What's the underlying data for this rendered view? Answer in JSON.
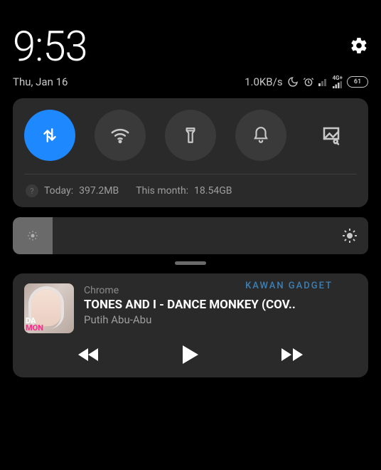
{
  "header": {
    "time": "9:53",
    "date": "Thu, Jan 16",
    "net_speed": "1.0KB/s",
    "network_badge": "4G+",
    "battery_pct": "61"
  },
  "qs": {
    "data_usage_today_label": "Today:",
    "data_usage_today_value": "397.2MB",
    "data_usage_month_label": "This month:",
    "data_usage_month_value": "18.54GB"
  },
  "media": {
    "watermark": "KAWAN GADGET",
    "app": "Chrome",
    "title": "TONES AND I - DANCE MONKEY (COV..",
    "artist": "Putih Abu-Abu",
    "art_line1": "DA",
    "art_line2": "MON"
  }
}
